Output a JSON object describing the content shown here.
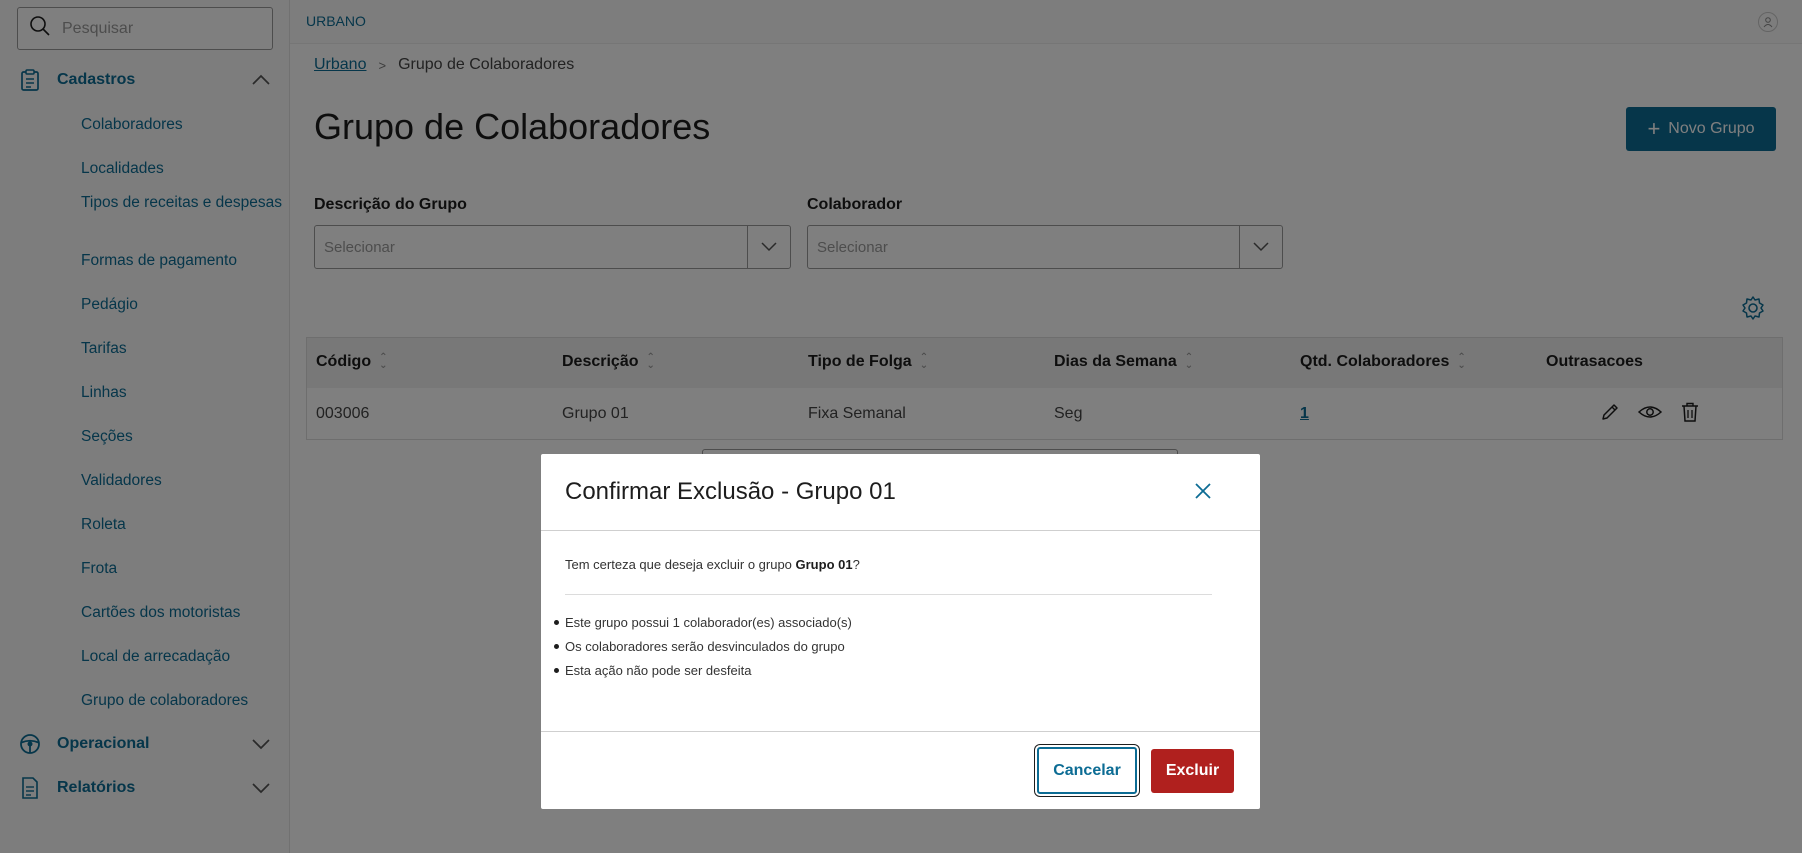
{
  "sidebar": {
    "search_placeholder": "Pesquisar",
    "groups": [
      {
        "label": "Cadastros",
        "icon": "clipboard-icon",
        "expanded": true
      },
      {
        "label": "Operacional",
        "icon": "steering-wheel-icon",
        "expanded": false
      },
      {
        "label": "Relatórios",
        "icon": "document-icon",
        "expanded": false
      }
    ],
    "cadastros_items": [
      "Colaboradores",
      "Localidades",
      "Tipos de receitas e despesas",
      "Formas de pagamento",
      "Pedágio",
      "Tarifas",
      "Linhas",
      "Seções",
      "Validadores",
      "Roleta",
      "Frota",
      "Cartões dos motoristas",
      "Local de arrecadação",
      "Grupo de colaboradores"
    ]
  },
  "header": {
    "app_name": "URBANO"
  },
  "breadcrumb": {
    "link": "Urbano",
    "current": "Grupo de Colaboradores"
  },
  "page": {
    "title": "Grupo de Colaboradores",
    "new_button": "Novo Grupo"
  },
  "filters": {
    "group_label": "Descrição do Grupo",
    "group_placeholder": "Selecionar",
    "collab_label": "Colaborador",
    "collab_placeholder": "Selecionar"
  },
  "table": {
    "headers": [
      "Código",
      "Descrição",
      "Tipo de Folga",
      "Dias da Semana",
      "Qtd. Colaboradores",
      "Outrasacoes"
    ],
    "rows": [
      {
        "codigo": "003006",
        "descricao": "Grupo 01",
        "tipo_folga": "Fixa Semanal",
        "dias": "Seg",
        "qtd": "1"
      }
    ]
  },
  "modal": {
    "title": "Confirmar Exclusão - Grupo 01",
    "message_prefix": "Tem certeza que deseja excluir o grupo ",
    "message_group": "Grupo 01",
    "message_suffix": "?",
    "bullets": [
      "Este grupo possui 1 colaborador(es) associado(s)",
      "Os colaboradores serão desvinculados do grupo",
      "Esta ação não pode ser desfeita"
    ],
    "cancel_label": "Cancelar",
    "confirm_label": "Excluir"
  },
  "colors": {
    "primary": "#0c6c94",
    "danger": "#b0201e",
    "overlay": "rgba(0,0,0,0.5)"
  }
}
